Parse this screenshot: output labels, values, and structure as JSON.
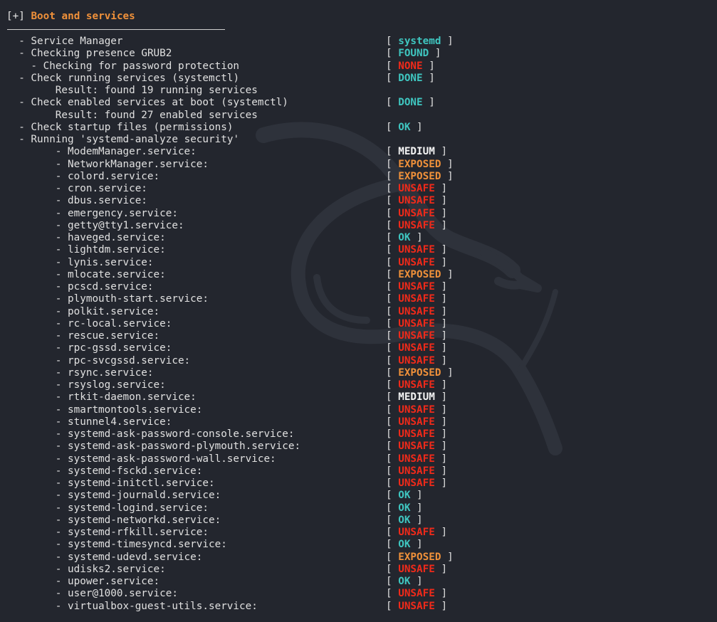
{
  "header": {
    "prefix": "[+]",
    "title": "Boot and services"
  },
  "colors": {
    "background": "#23262e",
    "ok": "#3fc6c0",
    "unsafe": "#f02a1a",
    "exposed": "#f0913a",
    "medium": "#f4f4f4"
  },
  "rows": [
    {
      "label": "- Service Manager",
      "indent": 2,
      "status": "systemd",
      "color": "cyan"
    },
    {
      "label": "- Checking presence GRUB2",
      "indent": 2,
      "status": "FOUND",
      "color": "cyan"
    },
    {
      "label": "- Checking for password protection",
      "indent": 4,
      "status": "NONE",
      "color": "red"
    },
    {
      "label": "- Check running services (systemctl)",
      "indent": 2,
      "status": "DONE",
      "color": "cyan"
    },
    {
      "label": "Result: found 19 running services",
      "indent": 8,
      "status": null,
      "color": null
    },
    {
      "label": "- Check enabled services at boot (systemctl)",
      "indent": 2,
      "status": "DONE",
      "color": "cyan"
    },
    {
      "label": "Result: found 27 enabled services",
      "indent": 8,
      "status": null,
      "color": null
    },
    {
      "label": "- Check startup files (permissions)",
      "indent": 2,
      "status": "OK",
      "color": "cyan"
    },
    {
      "label": "- Running 'systemd-analyze security'",
      "indent": 2,
      "status": null,
      "color": null
    },
    {
      "label": "- ModemManager.service:",
      "indent": 8,
      "status": "MEDIUM",
      "color": "white"
    },
    {
      "label": "- NetworkManager.service:",
      "indent": 8,
      "status": "EXPOSED",
      "color": "orange"
    },
    {
      "label": "- colord.service:",
      "indent": 8,
      "status": "EXPOSED",
      "color": "orange"
    },
    {
      "label": "- cron.service:",
      "indent": 8,
      "status": "UNSAFE",
      "color": "red"
    },
    {
      "label": "- dbus.service:",
      "indent": 8,
      "status": "UNSAFE",
      "color": "red"
    },
    {
      "label": "- emergency.service:",
      "indent": 8,
      "status": "UNSAFE",
      "color": "red"
    },
    {
      "label": "- getty@tty1.service:",
      "indent": 8,
      "status": "UNSAFE",
      "color": "red"
    },
    {
      "label": "- haveged.service:",
      "indent": 8,
      "status": "OK",
      "color": "cyan"
    },
    {
      "label": "- lightdm.service:",
      "indent": 8,
      "status": "UNSAFE",
      "color": "red"
    },
    {
      "label": "- lynis.service:",
      "indent": 8,
      "status": "UNSAFE",
      "color": "red"
    },
    {
      "label": "- mlocate.service:",
      "indent": 8,
      "status": "EXPOSED",
      "color": "orange"
    },
    {
      "label": "- pcscd.service:",
      "indent": 8,
      "status": "UNSAFE",
      "color": "red"
    },
    {
      "label": "- plymouth-start.service:",
      "indent": 8,
      "status": "UNSAFE",
      "color": "red"
    },
    {
      "label": "- polkit.service:",
      "indent": 8,
      "status": "UNSAFE",
      "color": "red"
    },
    {
      "label": "- rc-local.service:",
      "indent": 8,
      "status": "UNSAFE",
      "color": "red"
    },
    {
      "label": "- rescue.service:",
      "indent": 8,
      "status": "UNSAFE",
      "color": "red"
    },
    {
      "label": "- rpc-gssd.service:",
      "indent": 8,
      "status": "UNSAFE",
      "color": "red"
    },
    {
      "label": "- rpc-svcgssd.service:",
      "indent": 8,
      "status": "UNSAFE",
      "color": "red"
    },
    {
      "label": "- rsync.service:",
      "indent": 8,
      "status": "EXPOSED",
      "color": "orange"
    },
    {
      "label": "- rsyslog.service:",
      "indent": 8,
      "status": "UNSAFE",
      "color": "red"
    },
    {
      "label": "- rtkit-daemon.service:",
      "indent": 8,
      "status": "MEDIUM",
      "color": "white"
    },
    {
      "label": "- smartmontools.service:",
      "indent": 8,
      "status": "UNSAFE",
      "color": "red"
    },
    {
      "label": "- stunnel4.service:",
      "indent": 8,
      "status": "UNSAFE",
      "color": "red"
    },
    {
      "label": "- systemd-ask-password-console.service:",
      "indent": 8,
      "status": "UNSAFE",
      "color": "red"
    },
    {
      "label": "- systemd-ask-password-plymouth.service:",
      "indent": 8,
      "status": "UNSAFE",
      "color": "red"
    },
    {
      "label": "- systemd-ask-password-wall.service:",
      "indent": 8,
      "status": "UNSAFE",
      "color": "red"
    },
    {
      "label": "- systemd-fsckd.service:",
      "indent": 8,
      "status": "UNSAFE",
      "color": "red"
    },
    {
      "label": "- systemd-initctl.service:",
      "indent": 8,
      "status": "UNSAFE",
      "color": "red"
    },
    {
      "label": "- systemd-journald.service:",
      "indent": 8,
      "status": "OK",
      "color": "cyan"
    },
    {
      "label": "- systemd-logind.service:",
      "indent": 8,
      "status": "OK",
      "color": "cyan"
    },
    {
      "label": "- systemd-networkd.service:",
      "indent": 8,
      "status": "OK",
      "color": "cyan"
    },
    {
      "label": "- systemd-rfkill.service:",
      "indent": 8,
      "status": "UNSAFE",
      "color": "red"
    },
    {
      "label": "- systemd-timesyncd.service:",
      "indent": 8,
      "status": "OK",
      "color": "cyan"
    },
    {
      "label": "- systemd-udevd.service:",
      "indent": 8,
      "status": "EXPOSED",
      "color": "orange"
    },
    {
      "label": "- udisks2.service:",
      "indent": 8,
      "status": "UNSAFE",
      "color": "red"
    },
    {
      "label": "- upower.service:",
      "indent": 8,
      "status": "OK",
      "color": "cyan"
    },
    {
      "label": "- user@1000.service:",
      "indent": 8,
      "status": "UNSAFE",
      "color": "red"
    },
    {
      "label": "- virtualbox-guest-utils.service:",
      "indent": 8,
      "status": "UNSAFE",
      "color": "red"
    }
  ]
}
